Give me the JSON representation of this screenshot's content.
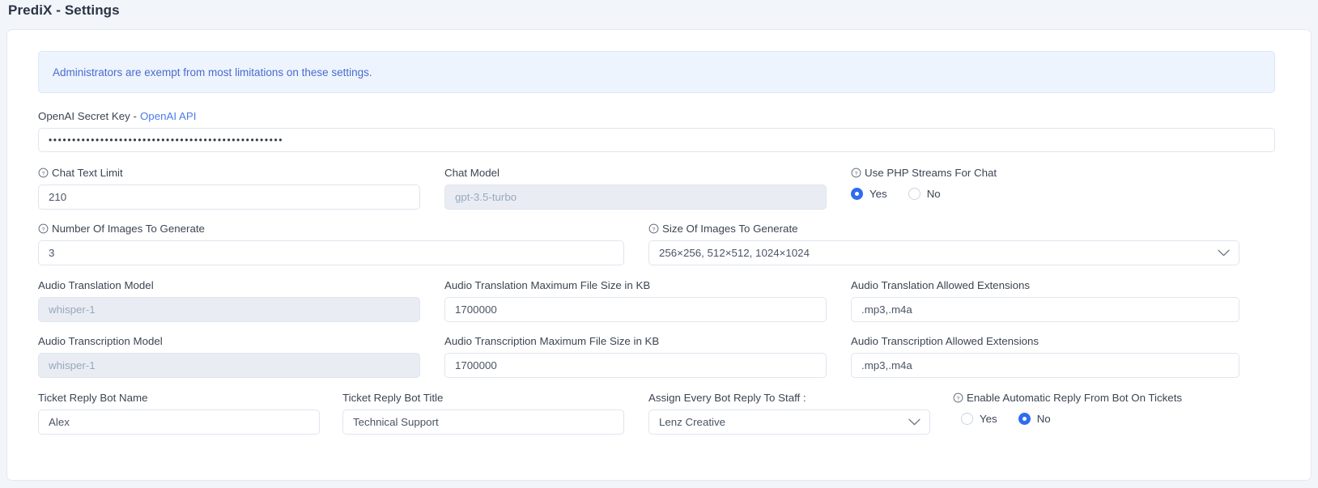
{
  "page": {
    "title": "PrediX - Settings"
  },
  "alert": {
    "message": "Administrators are exempt from most limitations on these settings."
  },
  "colors": {
    "accent": "#2f6cf0",
    "link": "#4c7ced",
    "alert_bg": "#eef4fd",
    "alert_text": "#4a6bd0",
    "page_bg": "#f2f5f9",
    "card_bg": "#ffffff",
    "disabled_bg": "#e9edf3"
  },
  "fields": {
    "secret_key": {
      "label": "OpenAI Secret Key - ",
      "link_label": "OpenAI API",
      "value": "••••••••••••••••••••••••••••••••••••••••••••••••••",
      "placeholder": ""
    },
    "chat_text_limit": {
      "label": "Chat Text Limit",
      "icon": "help-circle-icon",
      "value": "210",
      "placeholder": ""
    },
    "chat_model": {
      "label": "Chat Model",
      "value": "gpt-3.5-turbo",
      "placeholder": "gpt-3.5-turbo",
      "disabled": true
    },
    "php_streams": {
      "label": "Use PHP Streams For Chat",
      "icon": "help-circle-icon",
      "options": [
        "Yes",
        "No"
      ],
      "selected": "Yes"
    },
    "num_images": {
      "label": "Number Of Images To Generate",
      "icon": "help-circle-icon",
      "value": "3",
      "placeholder": ""
    },
    "size_images": {
      "label": "Size Of Images To Generate",
      "icon": "help-circle-icon",
      "selected": "256×256, 512×512, 1024×1024",
      "options": [
        "256×256, 512×512, 1024×1024"
      ],
      "chevron": "chevron-down-icon"
    },
    "audio_translation_model": {
      "label": "Audio Translation Model",
      "value": "whisper-1",
      "placeholder": "whisper-1",
      "disabled": true
    },
    "audio_translation_max_size": {
      "label": "Audio Translation Maximum File Size in KB",
      "value": "1700000",
      "placeholder": ""
    },
    "audio_translation_extensions": {
      "label": "Audio Translation Allowed Extensions",
      "value": ".mp3,.m4a",
      "placeholder": ""
    },
    "audio_transcription_model": {
      "label": "Audio Transcription Model",
      "value": "whisper-1",
      "placeholder": "whisper-1",
      "disabled": true
    },
    "audio_transcription_max_size": {
      "label": "Audio Transcription Maximum File Size in KB",
      "value": "1700000",
      "placeholder": ""
    },
    "audio_transcription_extensions": {
      "label": "Audio Transcription Allowed Extensions",
      "value": ".mp3,.m4a",
      "placeholder": ""
    },
    "ticket_bot_name": {
      "label": "Ticket Reply Bot Name",
      "value": "Alex",
      "placeholder": ""
    },
    "ticket_bot_title": {
      "label": "Ticket Reply Bot Title",
      "value": "Technical Support",
      "placeholder": ""
    },
    "assign_staff": {
      "label": "Assign Every Bot Reply To Staff :",
      "selected": "Lenz Creative",
      "options": [
        "Lenz Creative"
      ],
      "chevron": "chevron-down-icon"
    },
    "auto_reply": {
      "label": "Enable Automatic Reply From Bot On Tickets",
      "icon": "help-circle-icon",
      "options": [
        "Yes",
        "No"
      ],
      "selected": "No"
    }
  }
}
